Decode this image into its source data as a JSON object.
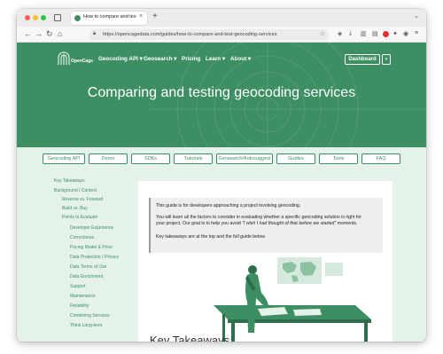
{
  "browser": {
    "tab_title": "How to compare and test geoco",
    "url": "https://opencagedata.com/guides/how-to-compare-and-test-geocoding-services",
    "new_tab": "+",
    "close": "×"
  },
  "site": {
    "logo_text": "OpenCage",
    "nav": [
      "Geocoding API ▾",
      "Geosearch ▾",
      "Pricing",
      "Learn ▾",
      "About ▾"
    ],
    "dashboard_label": "Dashboard",
    "hero_title": "Comparing and testing geocoding services",
    "pills": [
      "Geocoding API",
      "Demo",
      "SDKs",
      "Tutorials",
      "Geosearch/Autosuggest",
      "Guides",
      "Tools",
      "FAQ"
    ]
  },
  "toc": [
    "Key Takeaways",
    "Background / Context",
    "Reverse vs. Forward",
    "Build vs. Buy",
    "Points to Evaluate",
    "Developer Experience",
    "Correctness",
    "Pricing Model & Price",
    "Data Protection / Privacy",
    "Data Terms of Use",
    "Data Enrichment",
    "Support",
    "Maintenance",
    "Reliability",
    "Combining Services",
    "Think Long-term"
  ],
  "note": {
    "p1": "This guide is for developers approaching a project involving geocoding.",
    "p2a": "You will learn all the factors to consider in evaluating whether a specific geocoding solution is right for",
    "p2b": "your project. Our goal is to help you avoid ",
    "p2_quote": "\"I wish I had thought of that before we started\"",
    "p2c": " moments.",
    "p3": "Key takeaways are at the top and the full guide below."
  },
  "section_heading_peek": "Key Takeaways",
  "colors": {
    "brand_green": "#3d8f63",
    "light_green_bg": "#e5f2ea",
    "note_bg": "#eeeeee"
  }
}
